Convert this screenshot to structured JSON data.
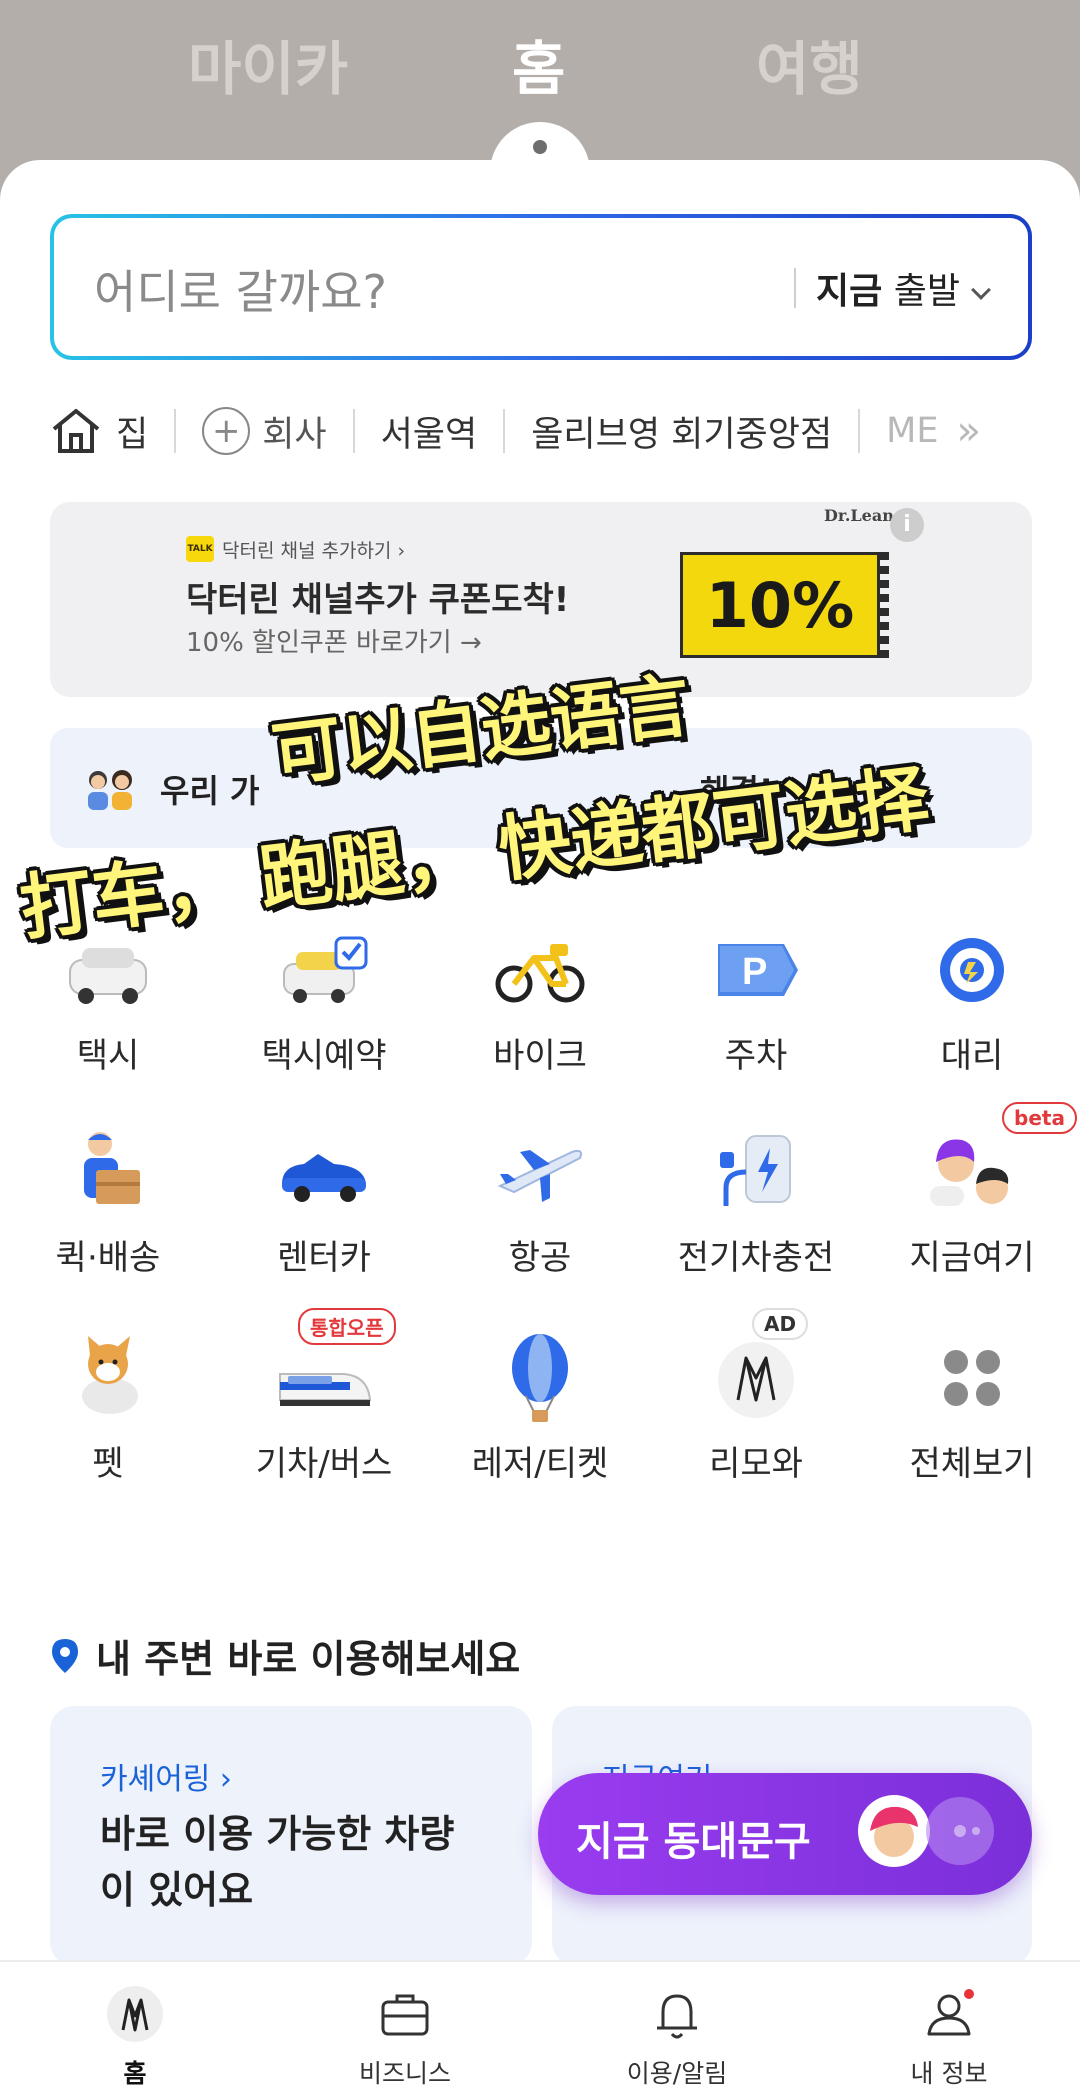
{
  "top_tabs": [
    "마이카",
    "홈",
    "여행"
  ],
  "search": {
    "placeholder": "어디로 갈까요?",
    "when_bold": "지금",
    "when_rest": "출발"
  },
  "shortcuts": {
    "home": "집",
    "company": "회사",
    "seoul_station": "서울역",
    "oliveyoung": "올리브영 회기중앙점",
    "more": "ME",
    "more_arrow": "»"
  },
  "banner": {
    "channel_label": "닥터린 채널 추가하기 ›",
    "kakao": "TALK",
    "title": "닥터린 채널추가 쿠폰도착!",
    "subtitle": "10% 할인쿠폰 바로가기 →",
    "coupon_text": "10%",
    "brand": "Dr.Lean",
    "info": "i"
  },
  "notice": {
    "text_left": "우리 가",
    "text_right": "해결!"
  },
  "services": [
    {
      "label": "택시"
    },
    {
      "label": "택시예약"
    },
    {
      "label": "바이크"
    },
    {
      "label": "주차"
    },
    {
      "label": "대리"
    },
    {
      "label": "퀵·배송"
    },
    {
      "label": "렌터카"
    },
    {
      "label": "항공"
    },
    {
      "label": "전기차충전"
    },
    {
      "label": "지금여기",
      "badge": "beta"
    },
    {
      "label": "펫"
    },
    {
      "label": "기차/버스",
      "badge": "통합오픈"
    },
    {
      "label": "레저/티켓"
    },
    {
      "label": "리모와",
      "badge": "AD"
    },
    {
      "label": "전체보기"
    }
  ],
  "nearby": {
    "title": "내 주변 바로 이용해보세요",
    "card1_link": "카셰어링 ›",
    "card1_text": "바로 이용 가능한 차량이 있어요",
    "card2_link": "지금여기 ›"
  },
  "floater": {
    "text": "지금 동대문구"
  },
  "bottom_nav": [
    "홈",
    "비즈니스",
    "이용/알림",
    "내 정보"
  ],
  "captions": {
    "line1": "可以自选语言",
    "line2": "打车，  跑腿，  快递都可选择"
  },
  "colors": {
    "header_bg": "#b3aeaa",
    "accent_blue": "#1a62d8",
    "floater_purple": "#8a35e6",
    "caption_yellow": "#fff57a"
  }
}
